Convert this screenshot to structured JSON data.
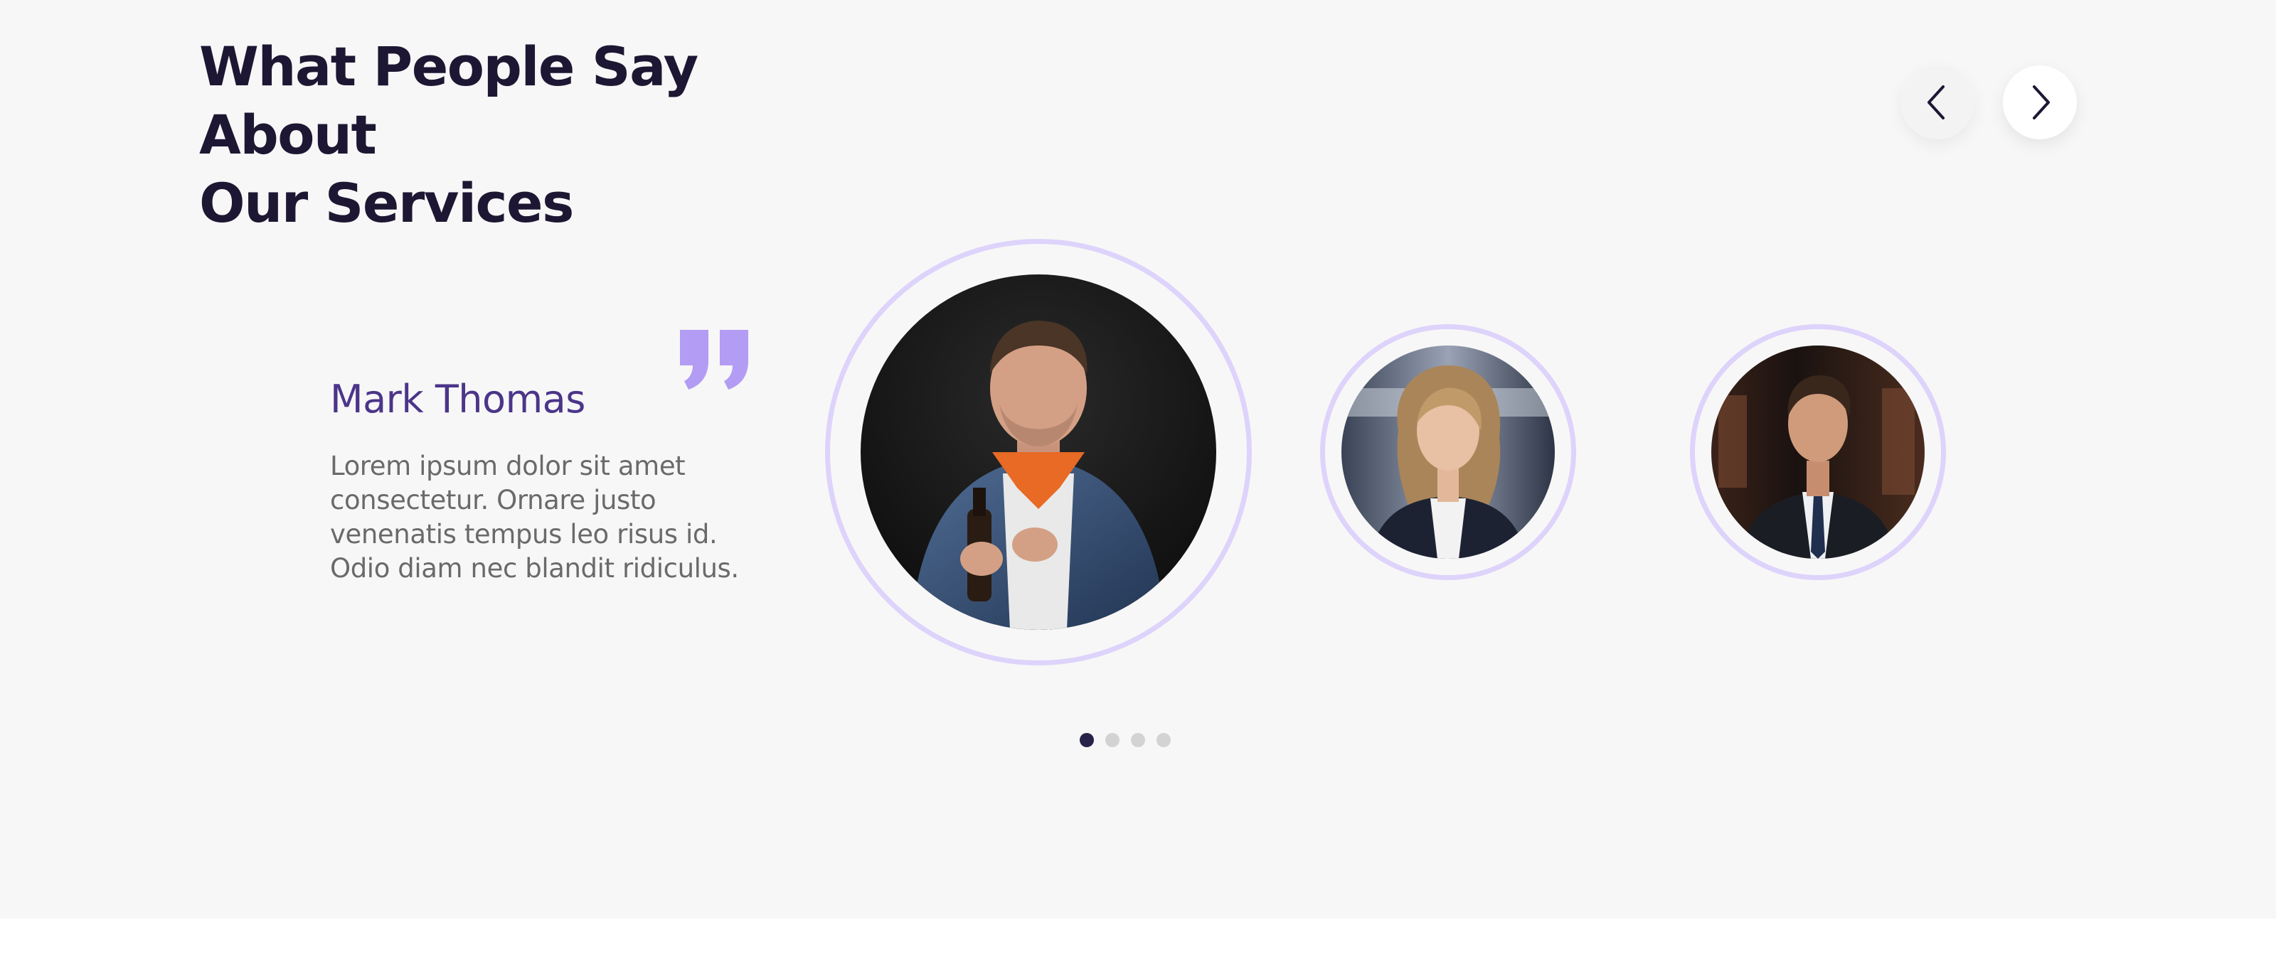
{
  "section": {
    "heading_line1": "What People Say About",
    "heading_line2": "Our Services"
  },
  "navigation": {
    "prev_icon": "chevron-left-icon",
    "next_icon": "chevron-right-icon"
  },
  "testimonial": {
    "name": "Mark Thomas",
    "text": "Lorem ipsum dolor sit amet consectetur. Ornare justo venenatis tempus leo risus id. Odio diam nec blandit ridiculus.",
    "quote_icon": "quote-icon"
  },
  "slides": {
    "count": 4,
    "active_index": 0
  },
  "colors": {
    "background": "#f7f7f7",
    "heading": "#1d1733",
    "name": "#4b3589",
    "accent": "#b39cf3",
    "ring": "#ddd3fb",
    "dot_active": "#272447",
    "dot_inactive": "#d3d3d3"
  }
}
